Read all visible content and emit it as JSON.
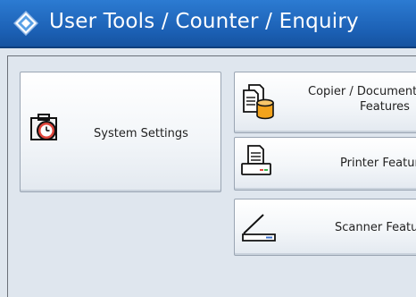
{
  "header": {
    "title": "User Tools / Counter / Enquiry",
    "title_icon": "user-tools-diamond-icon"
  },
  "buttons": {
    "system_settings": {
      "label": "System Settings",
      "icon": "clock-case-icon"
    },
    "copier": {
      "label_line1": "Copier / Document",
      "label_line2": "Features",
      "icon": "copier-icon"
    },
    "printer": {
      "label": "Printer Featur",
      "icon": "printer-icon"
    },
    "scanner": {
      "label": "Scanner Featu",
      "icon": "scanner-icon"
    }
  },
  "colors": {
    "titlebar": "#1b5fb3",
    "background": "#dfe6ee",
    "button_border": "#9aa5b3",
    "clock_red": "#e0453b",
    "db_orange": "#f2a31c"
  }
}
